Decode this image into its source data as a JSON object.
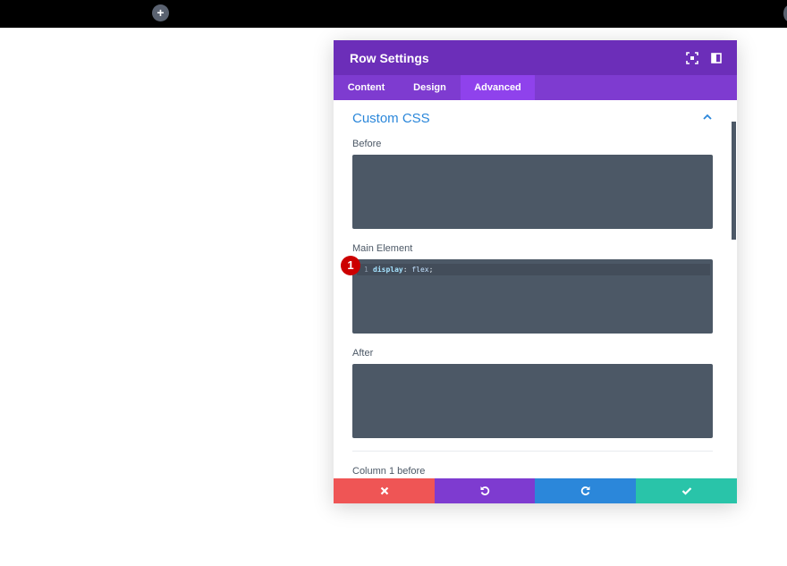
{
  "topbar": {
    "add_icon": "plus-icon",
    "add_glyph": "+"
  },
  "modal": {
    "title": "Row Settings",
    "header_icons": [
      "fullscreen-icon",
      "sidebar-icon"
    ],
    "tabs": [
      {
        "label": "Content",
        "active": false
      },
      {
        "label": "Design",
        "active": false
      },
      {
        "label": "Advanced",
        "active": true
      }
    ],
    "section": {
      "title": "Custom CSS",
      "toggle_icon": "chevron-up-icon"
    },
    "fields": [
      {
        "label": "Before",
        "code": []
      },
      {
        "label": "Main Element",
        "code": [
          {
            "line": "1",
            "property": "display",
            "value": "flex"
          }
        ]
      },
      {
        "label": "After",
        "code": []
      },
      {
        "label": "Column 1 before",
        "code": []
      }
    ],
    "step_badge": "1",
    "footer": [
      {
        "action": "cancel",
        "icon": "close-icon",
        "color": "#ef5555"
      },
      {
        "action": "undo",
        "icon": "undo-icon",
        "color": "#7e3bd0"
      },
      {
        "action": "redo",
        "icon": "redo-icon",
        "color": "#2b87da"
      },
      {
        "action": "save",
        "icon": "check-icon",
        "color": "#29c4a9"
      }
    ]
  },
  "colors": {
    "header": "#6c2eb9",
    "tabs": "#7e3bd0",
    "tab_active": "#8f42ec",
    "section_title": "#2b87da",
    "code_bg": "#4c5866",
    "badge": "#cc0000"
  }
}
